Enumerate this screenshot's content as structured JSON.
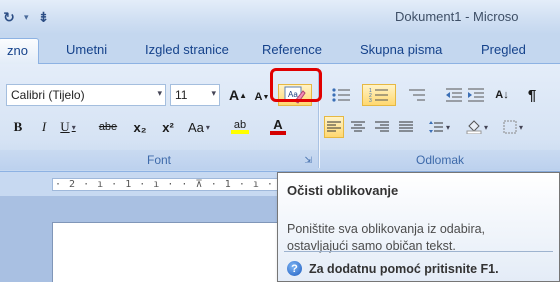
{
  "window": {
    "title": "Dokument1 - Microso"
  },
  "qat": {
    "redo_icon": "↻",
    "dropdown": "▾",
    "customize": "⇟"
  },
  "tabs": [
    {
      "label": "zno"
    },
    {
      "label": "Umetni"
    },
    {
      "label": "Izgled stranice"
    },
    {
      "label": "Reference"
    },
    {
      "label": "Skupna pisma"
    },
    {
      "label": "Pregled"
    }
  ],
  "font_group": {
    "label": "Font",
    "font_name": "Calibri (Tijelo)",
    "font_size": "11",
    "grow": "A",
    "shrink": "A",
    "bold": "B",
    "italic": "I",
    "underline": "U",
    "strike": "abe",
    "subscript": "x₂",
    "superscript": "x²",
    "change_case": "Aa",
    "highlight": "ab",
    "font_color": "A"
  },
  "paragraph_group": {
    "label": "Odlomak",
    "sort": "A↓",
    "pilcrow": "¶"
  },
  "ruler": {
    "text": "· 2 · ı · 1 · ı ·   · ⊼ · 1 · ı · 2 · ı"
  },
  "tooltip": {
    "title": "Očisti oblikovanje",
    "body": "Poništite sva oblikovanja iz odabira, ostavljajući samo običan tekst.",
    "help": "Za dodatnu pomoć pritisnite F1.",
    "help_icon": "?"
  },
  "colors": {
    "highlight_red": "#e10000",
    "font_color_red": "#d40000",
    "highlight_yellow": "#ffff00"
  }
}
